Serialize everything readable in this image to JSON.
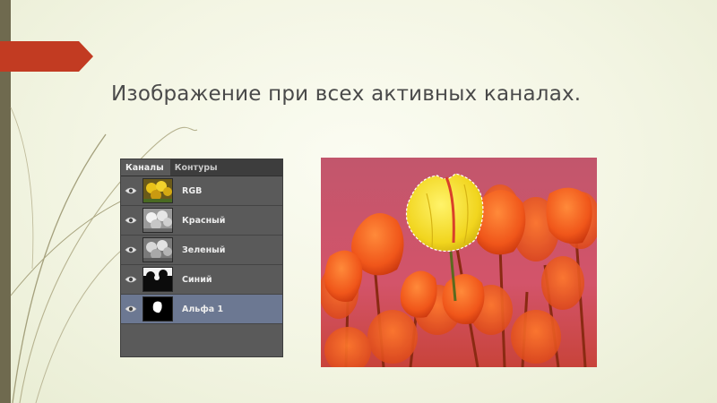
{
  "slide": {
    "title": "Изображение при всех активных каналах.",
    "colors": {
      "accent": "#c23b22",
      "sidebar": "#6f6a4f",
      "panel_bg": "#5a5a5a",
      "selected_row": "#6c7892"
    }
  },
  "channels_panel": {
    "tabs": [
      {
        "label": "Каналы",
        "active": true
      },
      {
        "label": "Контуры",
        "active": false
      }
    ],
    "channels": [
      {
        "label": "RGB",
        "icon": "eye-icon",
        "selected": false
      },
      {
        "label": "Красный",
        "icon": "eye-icon",
        "selected": false
      },
      {
        "label": "Зеленый",
        "icon": "eye-icon",
        "selected": false
      },
      {
        "label": "Синий",
        "icon": "eye-icon",
        "selected": false
      },
      {
        "label": "Альфа 1",
        "icon": "eye-icon",
        "selected": true
      }
    ]
  },
  "photo": {
    "subject": "tulip-photo"
  }
}
